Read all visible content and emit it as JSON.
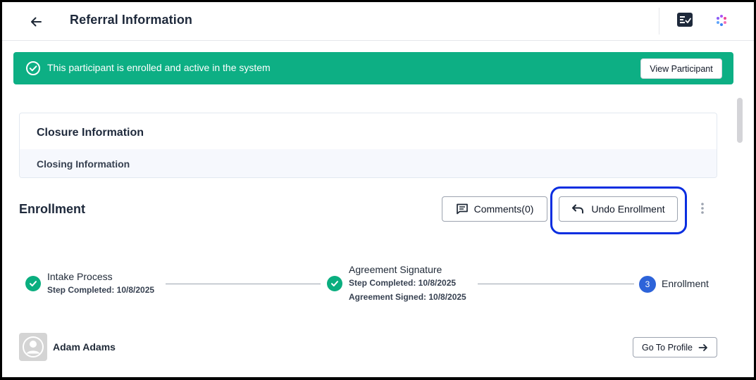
{
  "header": {
    "title": "Referral Information",
    "back_icon": "arrow-left-icon",
    "task_icon": "checklist-icon",
    "app_icon": "app-logo-icon"
  },
  "banner": {
    "message": "This participant is enrolled and active in the system",
    "button_label": "View Participant",
    "color": "#0daf84"
  },
  "closure": {
    "title": "Closure Information",
    "subtitle": "Closing Information"
  },
  "enrollment": {
    "title": "Enrollment",
    "comments_label": "Comments(0)",
    "undo_label": "Undo Enrollment",
    "highlight_color": "#0a2ee0"
  },
  "steps": [
    {
      "label": "Intake Process",
      "meta": [
        "Step Completed: 10/8/2025"
      ],
      "status": "completed"
    },
    {
      "label": "Agreement Signature",
      "meta": [
        "Step Completed: 10/8/2025",
        "Agreement Signed: 10/8/2025"
      ],
      "status": "completed"
    },
    {
      "label": "Enrollment",
      "number": "3",
      "status": "active"
    }
  ],
  "participant": {
    "name": "Adam Adams",
    "profile_button": "Go To Profile"
  }
}
